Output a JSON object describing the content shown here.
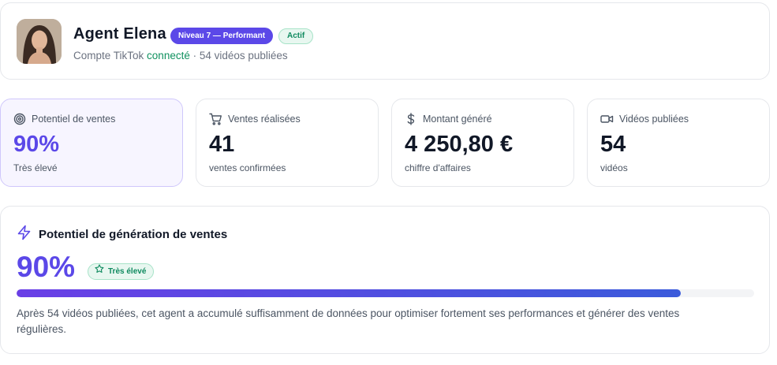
{
  "header": {
    "agent_name": "Agent Elena",
    "level_badge": "Niveau 7 — Performant",
    "status_badge": "Actif",
    "account_prefix": "Compte TikTok",
    "account_status": "connecté",
    "account_suffix": " · 54 vidéos publiées"
  },
  "stats": [
    {
      "label": "Potentiel de ventes",
      "value": "90%",
      "sub": "Très élevé",
      "icon": "target-icon"
    },
    {
      "label": "Ventes réalisées",
      "value": "41",
      "sub": "ventes confirmées",
      "icon": "cart-icon"
    },
    {
      "label": "Montant généré",
      "value": "4 250,80 €",
      "sub": "chiffre d'affaires",
      "icon": "dollar-icon"
    },
    {
      "label": "Vidéos publiées",
      "value": "54",
      "sub": "vidéos",
      "icon": "video-icon"
    }
  ],
  "potential": {
    "title": "Potentiel de génération de ventes",
    "value": "90%",
    "badge": "Très élevé",
    "progress_percent": 90,
    "description": "Après 54 vidéos publiées, cet agent a accumulé suffisamment de données pour optimiser fortement ses performances et générer des ventes régulières."
  },
  "colors": {
    "accent": "#5b48e8",
    "success": "#10915f"
  }
}
